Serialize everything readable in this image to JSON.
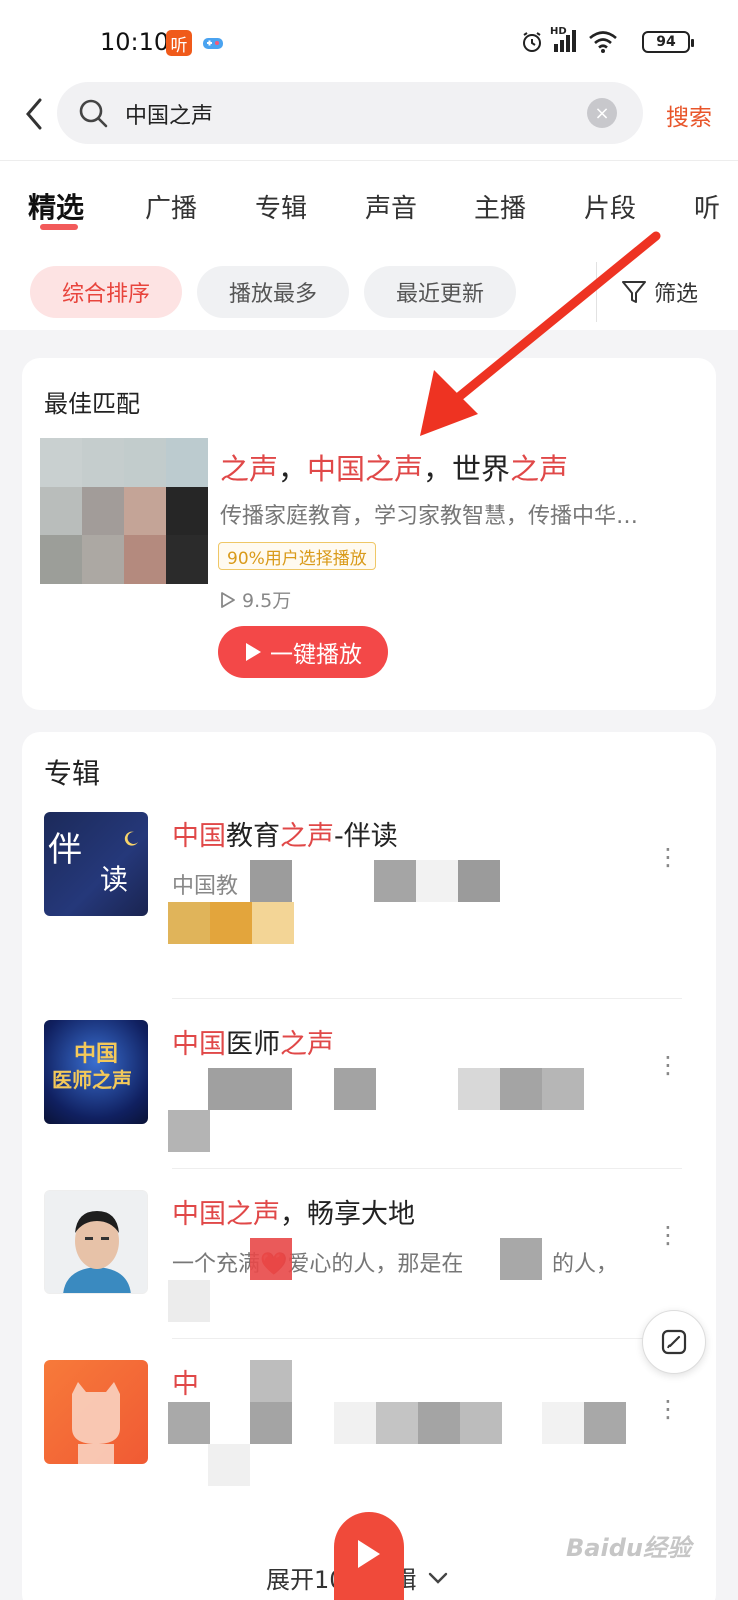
{
  "status_bar": {
    "time": "10:10",
    "network_label": "HD",
    "battery": "94",
    "app_icon_label": "听"
  },
  "search": {
    "query": "中国之声",
    "clear_icon": "×",
    "submit_label": "搜索"
  },
  "tabs": [
    {
      "label": "精选",
      "active": true
    },
    {
      "label": "广播"
    },
    {
      "label": "专辑"
    },
    {
      "label": "声音"
    },
    {
      "label": "主播"
    },
    {
      "label": "片段"
    },
    {
      "label": "听"
    }
  ],
  "sort_chips": [
    {
      "label": "综合排序",
      "active": true
    },
    {
      "label": "播放最多"
    },
    {
      "label": "最近更新"
    }
  ],
  "filter_label": "筛选",
  "best_match": {
    "section_title": "最佳匹配",
    "name_parts": [
      {
        "text": "之声",
        "hl": true
      },
      {
        "text": "，",
        "hl": false
      },
      {
        "text": "中国之声",
        "hl": true
      },
      {
        "text": "，世界",
        "hl": false
      },
      {
        "text": "之声",
        "hl": true
      }
    ],
    "description": "传播家庭教育，学习家教智慧，传播中华…",
    "badge": "90%用户选择播放",
    "play_count": "9.5万",
    "play_button": "一键播放"
  },
  "albums_section": {
    "title": "专辑",
    "items": [
      {
        "title_parts": [
          {
            "text": "中国",
            "hl": true
          },
          {
            "text": "教育",
            "hl": false
          },
          {
            "text": "之声",
            "hl": true
          },
          {
            "text": "-伴读",
            "hl": false
          }
        ],
        "subtitle": "中国教",
        "cover_text": [
          "伴",
          "读"
        ]
      },
      {
        "title_parts": [
          {
            "text": "中国",
            "hl": true
          },
          {
            "text": "医师",
            "hl": false
          },
          {
            "text": "之声",
            "hl": true
          }
        ],
        "subtitle": "",
        "cover_text": [
          "中国",
          "医师之声"
        ]
      },
      {
        "title_parts": [
          {
            "text": "中国之声",
            "hl": true
          },
          {
            "text": "，畅享大地",
            "hl": false
          }
        ],
        "subtitle": "一个充满❤️爱心的人，那是在",
        "subtitle_tail": "的人，"
      },
      {
        "title_parts": [
          {
            "text": "中",
            "hl": true
          }
        ],
        "subtitle": ""
      }
    ]
  },
  "expand_label": "展开10个专辑",
  "watermark": "Baidu经验"
}
